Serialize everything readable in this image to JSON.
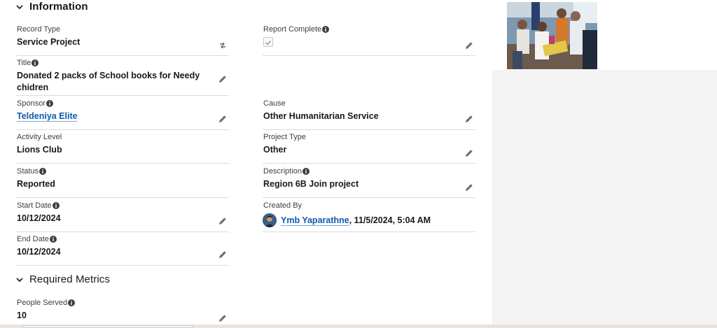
{
  "sections": {
    "information": {
      "title": "Information"
    },
    "metrics": {
      "title": "Required Metrics"
    }
  },
  "fields": {
    "record_type": {
      "label": "Record Type",
      "value": "Service Project"
    },
    "report_complete": {
      "label": "Report Complete",
      "checked": true
    },
    "title": {
      "label": "Title",
      "value_line1": "Donated 2 packs of School books for Needy",
      "value_line2": "chidren"
    },
    "sponsor": {
      "label": "Sponsor",
      "value": "Teldeniya Elite"
    },
    "cause": {
      "label": "Cause",
      "value": "Other Humanitarian Service"
    },
    "activity_level": {
      "label": "Activity Level",
      "value": "Lions Club"
    },
    "project_type": {
      "label": "Project Type",
      "value": "Other"
    },
    "status": {
      "label": "Status",
      "value": "Reported"
    },
    "description": {
      "label": "Description",
      "value": "Region 6B Join project"
    },
    "start_date": {
      "label": "Start Date",
      "value": "10/12/2024"
    },
    "created_by": {
      "label": "Created By",
      "user": "Ymb Yaparathne",
      "timestamp": ", 11/5/2024, 5:04 AM"
    },
    "end_date": {
      "label": "End Date",
      "value": "10/12/2024"
    },
    "people_served": {
      "label": "People Served",
      "value": "10"
    }
  },
  "colors": {
    "link": "#0b5cab",
    "border": "#dddbda",
    "label": "#3e3e3c",
    "panel_bg": "#f3f3f3"
  },
  "icons": {
    "section_toggle": "chevron-down-icon",
    "edit": "pencil-icon",
    "info": "info-icon",
    "record_type_change": "swap-icon",
    "checkbox": "checkmark-icon"
  }
}
